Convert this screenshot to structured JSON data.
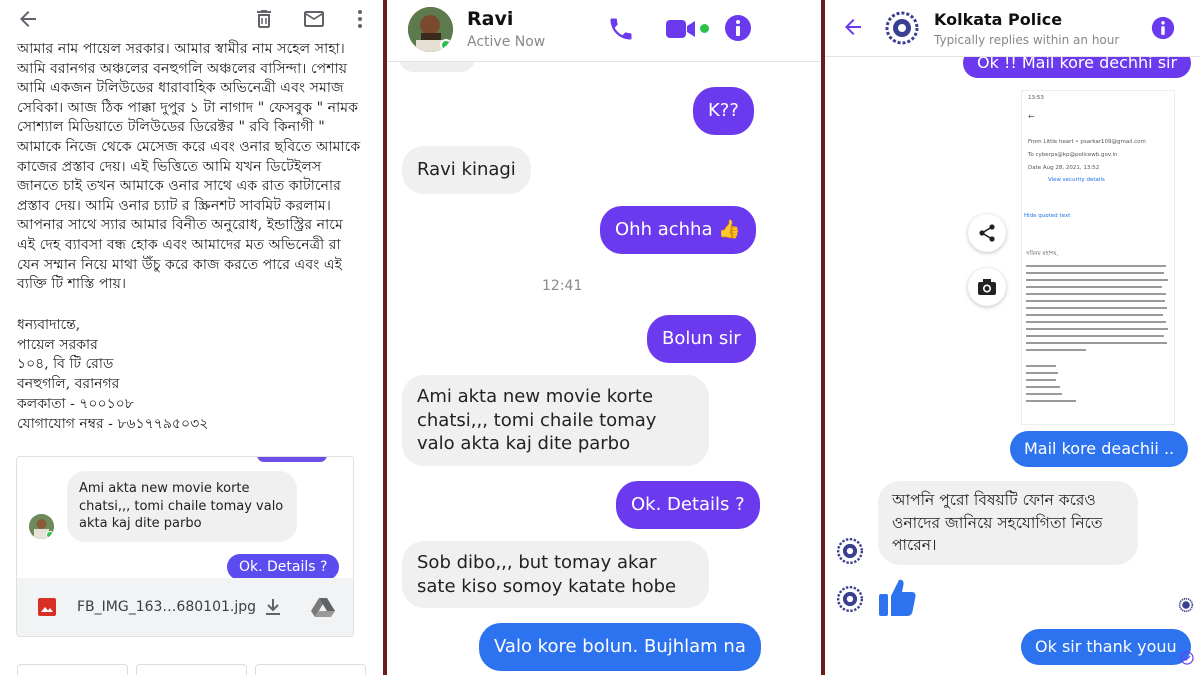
{
  "email_panel": {
    "icons": [
      "back-arrow-icon",
      "trash-icon",
      "mail-icon",
      "more-vert-icon"
    ],
    "body_lines": [
      "আমার নাম পায়েল সরকার। আমার স্বামীর নাম সহেল সাহা।",
      "আমি বরানগর অঞ্চলের বনহুগলি অঞ্চলের বাসিন্দা। পেশায়",
      "আমি একজন টলিউডের ধারাবাহিক অভিনেত্রী এবং সমাজ",
      "সেবিকা। আজ ঠিক পাক্কা দুপুর ১ টা নাগাদ \" ফেসবুক \" নামক",
      "সোশ্যাল মিডিয়াতে টলিউডের ডিরেক্টর \" রবি কিনাগী \"",
      "আমাকে নিজে থেকে মেসেজ করে এবং ওনার ছবিতে আমাকে",
      "কাজের প্রস্তাব দেয়। এই ভিত্তিতে আমি যখন ডিটেইলস",
      "জানতে চাই তখন আমাকে ওনার সাথে এক রাত কাটানোর",
      "প্রস্তাব দেয়। আমি ওনার চ্যাট র স্ক্রিনশট সাবমিট করলাম।",
      "আপনার সাথে স্যার আমার বিনীত অনুরোধ, ইন্ডাস্ট্রির নামে",
      "এই দেহ ব্যাবসা বন্ধ হোক এবং আমাদের মত অভিনেত্রী রা",
      "যেন সম্মান নিয়ে মাথা উঁচু করে কাজ করতে পারে এবং এই",
      "ব্যক্তি টি শাস্তি পায়।"
    ],
    "signature_lines": [
      "ধন্যবাদান্তে,",
      "পায়েল সরকার",
      "১০৪, বি টি রোড",
      "বনহুগলি, বরানগর",
      "কলকাতা - ৭০০১০৮",
      "যোগাযোগ নম্বর - ৮৬১৭৭৯৫০৩২"
    ],
    "attachment_preview": {
      "received_text": "Ami akta new movie korte chatsi,,, tomi chaile tomay valo akta kaj dite parbo",
      "sent_text": "Ok. Details ?"
    },
    "attachment_file": {
      "name": "FB_IMG_163…680101.jpg",
      "icons": [
        "image-file-icon",
        "download-icon",
        "drive-icon"
      ]
    }
  },
  "ravi_chat": {
    "contact_name": "Ravi",
    "status": "Active Now",
    "colors": {
      "accent": "#6b39ee",
      "sent_blue": "#2d73f0",
      "online": "#2bc14b"
    },
    "messages": [
      {
        "dir": "out",
        "text": "K??"
      },
      {
        "dir": "in",
        "text": "Ravi kinagi"
      },
      {
        "dir": "out",
        "text": "Ohh achha 👍"
      },
      {
        "dir": "out",
        "text": "Bolun sir"
      },
      {
        "dir": "in",
        "text": "Ami akta new movie korte chatsi,,, tomi chaile tomay valo akta kaj dite parbo"
      },
      {
        "dir": "out",
        "text": "Ok. Details ?"
      },
      {
        "dir": "in",
        "text": "Sob dibo,,, but tomay akar sate kiso somoy katate hobe"
      },
      {
        "dir": "out",
        "text": "Valo kore bolun. Bujhlam na"
      }
    ],
    "timestamp": "12:41"
  },
  "police_chat": {
    "contact_name": "Kolkata Police",
    "status": "Typically replies within an hour",
    "colors": {
      "accent": "#6b39ee",
      "sent_blue": "#2d73f0"
    },
    "messages": [
      {
        "dir": "out",
        "text": "Ok !! Mail kore dechhi sir"
      },
      {
        "dir": "out",
        "text": "Mail kore deachii .."
      },
      {
        "dir": "in",
        "text": "আপনি পুরো বিষয়টি ফোন করেও ওনাদের জানিয়ে সহযোগিতা নিতে পারেন।"
      },
      {
        "dir": "in",
        "emoji": "👍"
      },
      {
        "dir": "out",
        "text": "Ok sir thank youu"
      }
    ],
    "screenshot_preview": {
      "status_time": "13:53",
      "from": "From  Little heart • psarkar109@gmail.com",
      "to": "To     cyberps@kp@policewb.gov.in",
      "date": "Date  Aug 28, 2021, 13:52",
      "view_details": "View security details",
      "hide_quoted": "Hide quoted text",
      "greeting": "সবিনয় মহাশয়,"
    }
  }
}
